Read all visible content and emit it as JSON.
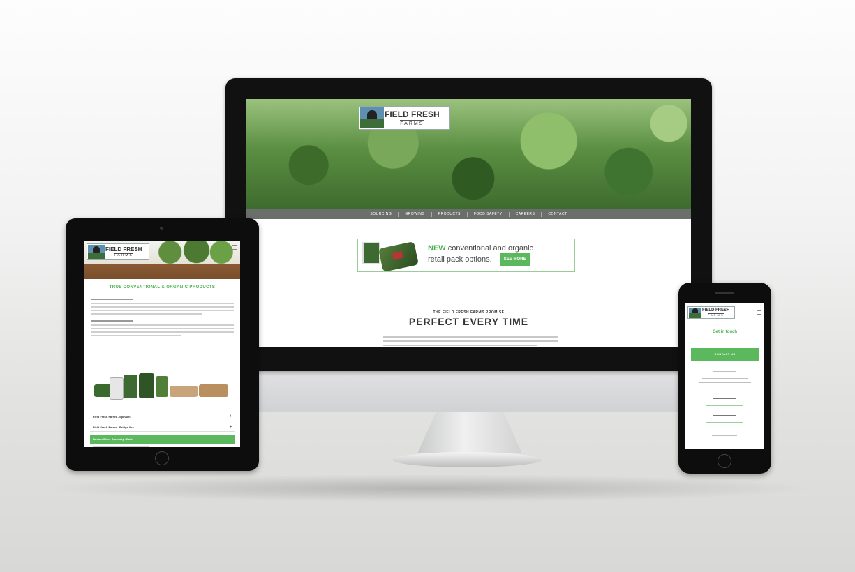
{
  "desktop": {
    "logo": {
      "main": "FIELD FRESH",
      "sub": "FARMS"
    },
    "nav": [
      "SOURCING",
      "GROWING",
      "PRODUCTS",
      "FOOD SAFETY",
      "CAREERS",
      "CONTACT"
    ],
    "promo": {
      "new_word": "NEW",
      "line1_rest": "conventional and organic",
      "line2": "retail pack options.",
      "button": "SEE MORE"
    },
    "promise_kicker": "THE FIELD FRESH FARMS PROMISE",
    "promise_title": "PERFECT EVERY TIME"
  },
  "tablet": {
    "logo": {
      "main": "FIELD FRESH",
      "sub": "FARMS"
    },
    "heading": "TRUE CONVENTIONAL & ORGANIC PRODUCTS",
    "rows": [
      {
        "label": "Field Fresh Farms - Spinach",
        "arrow": "+"
      },
      {
        "label": "Field Fresh Farms - Bridge line",
        "arrow": "+"
      },
      {
        "label": "Boston Silver Specialty - Bulk"
      }
    ]
  },
  "phone": {
    "logo": {
      "main": "FIELD FRESH",
      "sub": "FARMS"
    },
    "title": "Get in touch",
    "button": "CONTACT US"
  },
  "colors": {
    "accent_green": "#5cb85c",
    "nav_gray": "#6b6f6b",
    "bezel": "#111111"
  }
}
